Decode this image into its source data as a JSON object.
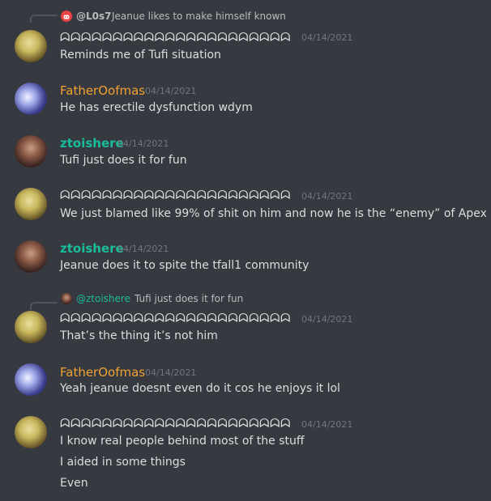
{
  "messages": [
    {
      "reply": {
        "author": "@L0s7",
        "text": "Jeanue likes to make himself known",
        "icon": "discord-logo-icon"
      },
      "author": "ᗣᗣᗣᗣᗣᗣᗣᗣᗣᗣᗣᗣᗣᗣᗣᗣᗣᗣᗣᗣᗣᗣ",
      "time": "04/14/2021",
      "lines": [
        "Reminds me of Tufi situation"
      ]
    },
    {
      "author": "FatherOofmas",
      "time": "04/14/2021",
      "lines": [
        "He has erectile dysfunction wdym"
      ]
    },
    {
      "author": "ztoishere",
      "time": "04/14/2021",
      "lines": [
        "Tufi just does it for fun"
      ]
    },
    {
      "author": "ᗣᗣᗣᗣᗣᗣᗣᗣᗣᗣᗣᗣᗣᗣᗣᗣᗣᗣᗣᗣᗣᗣ",
      "time": "04/14/2021",
      "lines": [
        "We just blamed like 99% of shit on him and now he is the “enemy” of Apex"
      ]
    },
    {
      "author": "ztoishere",
      "time": "04/14/2021",
      "lines": [
        "Jeanue does it to spite the tfall1 community"
      ]
    },
    {
      "reply": {
        "author": "@ztoishere",
        "text": "Tufi just does it for fun",
        "icon": "ztoishere-avatar-icon"
      },
      "author": "ᗣᗣᗣᗣᗣᗣᗣᗣᗣᗣᗣᗣᗣᗣᗣᗣᗣᗣᗣᗣᗣᗣ",
      "time": "04/14/2021",
      "lines": [
        "That’s the thing it’s not him"
      ]
    },
    {
      "author": "FatherOofmas",
      "time": "04/14/2021",
      "lines": [
        "Yeah jeanue doesnt even do it cos he enjoys it lol"
      ]
    },
    {
      "author": "ᗣᗣᗣᗣᗣᗣᗣᗣᗣᗣᗣᗣᗣᗣᗣᗣᗣᗣᗣᗣᗣᗣ",
      "time": "04/14/2021",
      "lines": [
        "I know real people behind most of the stuff",
        "I aided in some things",
        "Even"
      ]
    }
  ],
  "colors": {
    "background": "#36393f",
    "username_orange": "#f0a232",
    "username_green": "#1abc9c",
    "timestamp": "#72767d",
    "text": "#dcddde"
  }
}
